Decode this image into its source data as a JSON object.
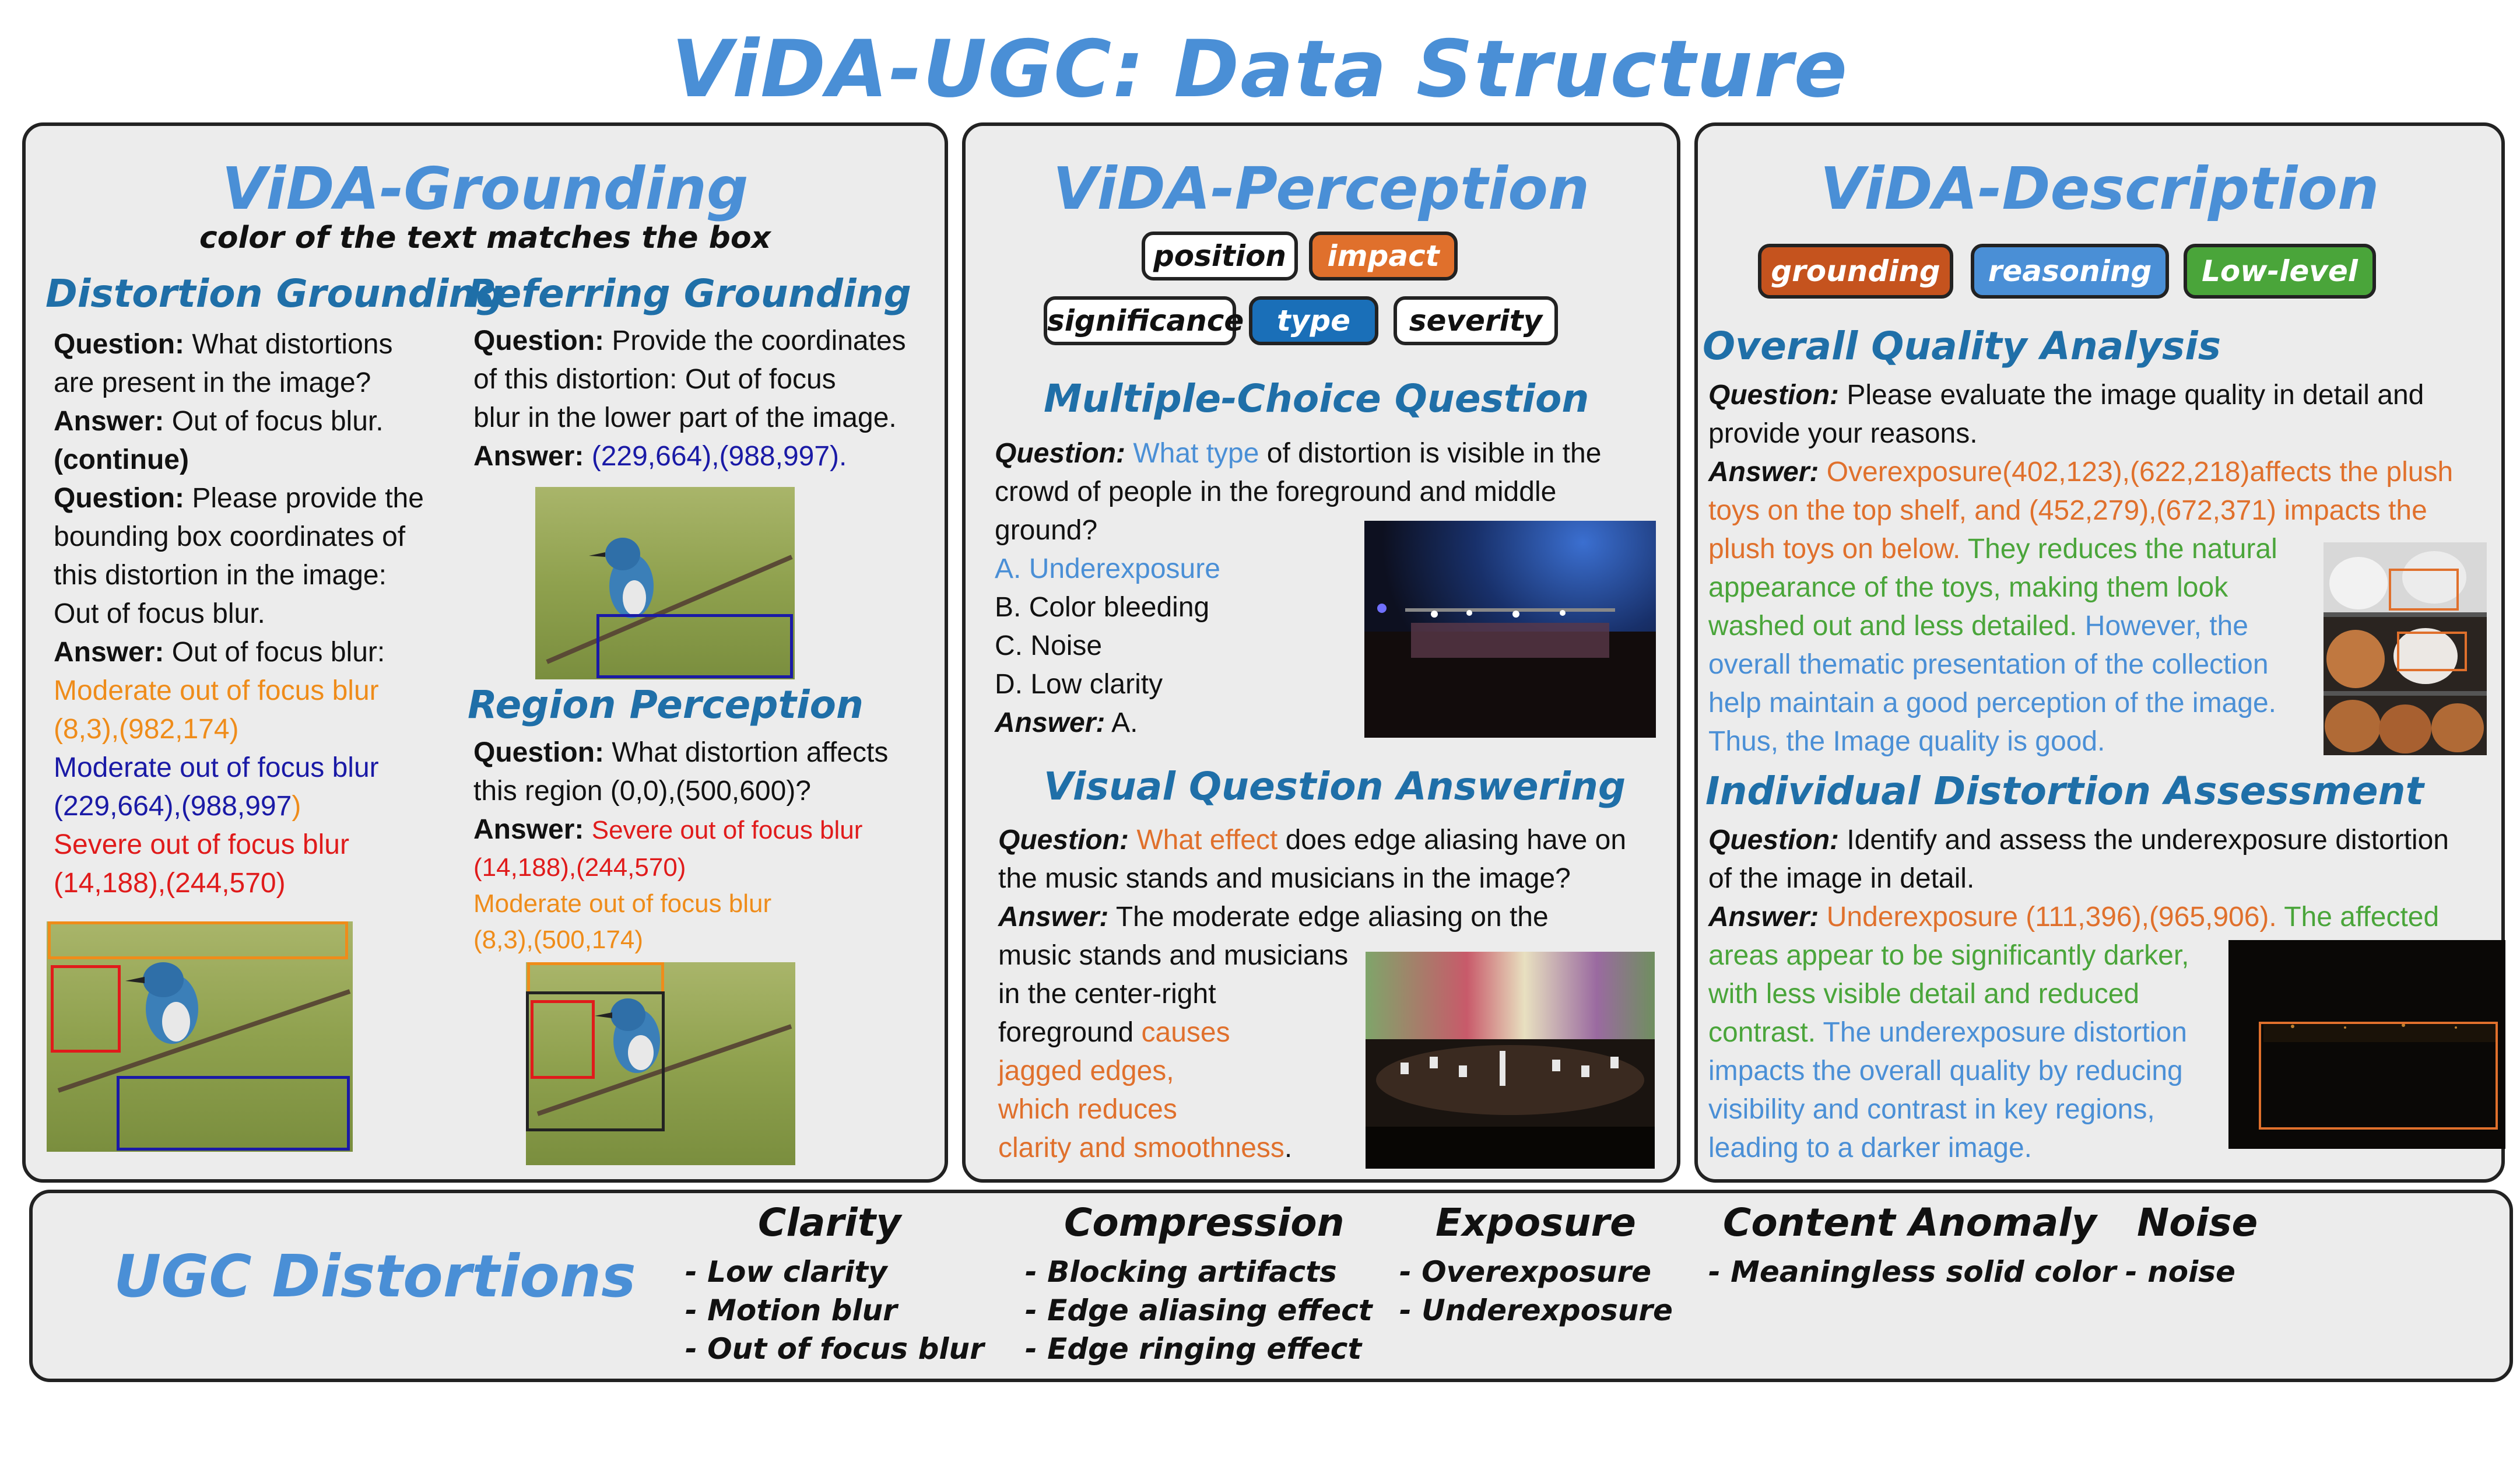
{
  "title": "ViDA-UGC: Data Structure",
  "grounding": {
    "title": "ViDA-Grounding",
    "subtitle": "color of the text matches the box",
    "distortion": {
      "heading": "Distortion Grounding",
      "q1_label": "Question:",
      "q1_line1": "What distortions",
      "q1_line2": "are present in the image?",
      "a1_label": "Answer:",
      "a1_text": "Out of focus blur.",
      "cont": "(continue)",
      "q2_label": "Question:",
      "q2_line1": "Please provide the",
      "q2_line2": "bounding box coordinates of",
      "q2_line3": "this distortion in the image:",
      "q2_line4": "Out of focus blur.",
      "a2_label": "Answer:",
      "a2_text": "Out of focus blur:",
      "r1a": "Moderate out of focus blur",
      "r1b": "(8,3),(982,174)",
      "r2a": "Moderate out of focus blur",
      "r2b": "(229,664),(988,997",
      "r2c": ")",
      "r3a": "Severe out of focus blur",
      "r3b": "(14,188),(244,570)"
    },
    "referring": {
      "heading": "Referring Grounding",
      "q_label": "Question:",
      "q_line1": "Provide the coordinates",
      "q_line2": "of this distortion: Out of focus",
      "q_line3": "blur in the lower part of the image.",
      "a_label": "Answer:",
      "a_text": "(229,664),(988,997)."
    },
    "region": {
      "heading": "Region Perception",
      "q_label": "Question:",
      "q_line1": "What distortion affects",
      "q_line2": "this region (0,0),(500,600)?",
      "a_label": "Answer:",
      "a1": "Severe out of focus blur",
      "a2": "(14,188),(244,570)",
      "a3": "Moderate out of focus blur",
      "a4": "(8,3),(500,174)"
    }
  },
  "perception": {
    "title": "ViDA-Perception",
    "tags": [
      "position",
      "impact",
      "significance",
      "type",
      "severity"
    ],
    "mcq": {
      "heading": "Multiple-Choice Question",
      "q_label": "Question:",
      "q_hl": "What type",
      "q_rest": "of distortion is visible in the",
      "q_line2": "crowd of people in the foreground and middle",
      "q_line3": "ground?",
      "options": [
        "A. Underexposure",
        "B. Color bleeding",
        "C. Noise",
        "D. Low clarity"
      ],
      "a_label": "Answer:",
      "a_text": "A."
    },
    "vqa": {
      "heading": "Visual Question Answering",
      "q_label": "Question:",
      "q_hl": "What effect",
      "q_rest": "does edge aliasing have on",
      "q_line2": "the music stands and musicians in the image?",
      "a_label": "Answer:",
      "a_line1": "The moderate edge aliasing on the",
      "a_line2": "music stands and musicians",
      "a_line3": "in the center-right",
      "a_line4": "foreground",
      "a_hl1": "causes",
      "a_hl2": "jagged edges,",
      "a_hl3": "which reduces",
      "a_hl4": "clarity and smoothness",
      "a_end": "."
    }
  },
  "description": {
    "title": "ViDA-Description",
    "tags": [
      "grounding",
      "reasoning",
      "Low-level"
    ],
    "overall": {
      "heading": "Overall Quality Analysis",
      "q_label": "Question:",
      "q_line1": "Please evaluate the image quality in detail and",
      "q_line2": "provide your reasons.",
      "a_label": "Answer:",
      "o1": "Overexposure(402,123),(622,218)affects the plush",
      "o2": "toys on the top shelf, and (452,279),(672,371) impacts the",
      "o3": "plush toys on below.",
      "g1": "They reduces the natural",
      "g2": "appearance of the toys, making them look",
      "g3": "washed out and less detailed.",
      "b1": "However, the",
      "b2": "overall thematic presentation of the collection",
      "b3": "help maintain a good perception of the image.",
      "b4": "Thus, the Image quality is good."
    },
    "individual": {
      "heading": "Individual Distortion Assessment",
      "q_label": "Question:",
      "q_line1": "Identify and assess the underexposure distortion",
      "q_line2": "of the image in detail.",
      "a_label": "Answer:",
      "o1": "Underexposure (111,396),(965,906).",
      "g1": "The affected",
      "g2": "areas appear to be significantly darker,",
      "g3": "with less visible detail and reduced",
      "g4": "contrast.",
      "b1": "The underexposure distortion",
      "b2": "impacts the overall quality by reducing",
      "b3": "visibility and contrast in key regions,",
      "b4": "leading to a darker image."
    }
  },
  "distortions": {
    "title": "UGC Distortions",
    "groups": [
      {
        "name": "Clarity",
        "items": [
          "- Low clarity",
          "- Motion blur",
          "- Out of focus blur"
        ]
      },
      {
        "name": "Compression",
        "items": [
          "- Blocking artifacts",
          "- Edge aliasing effect",
          "- Edge ringing effect"
        ]
      },
      {
        "name": "Exposure",
        "items": [
          "- Overexposure",
          "- Underexposure"
        ]
      },
      {
        "name": "Content Anomaly",
        "items": [
          "- Meaningless solid color"
        ]
      },
      {
        "name": "Noise",
        "items": [
          "- noise"
        ]
      }
    ]
  },
  "colors": {
    "title_blue": "#4a8fd6",
    "grounding_tag": "#c5531e",
    "reasoning_tag": "#4a8fd6",
    "lowlevel_tag": "#4aa53a",
    "impact_tag": "#e0702c",
    "type_tag": "#1a6fb8"
  }
}
